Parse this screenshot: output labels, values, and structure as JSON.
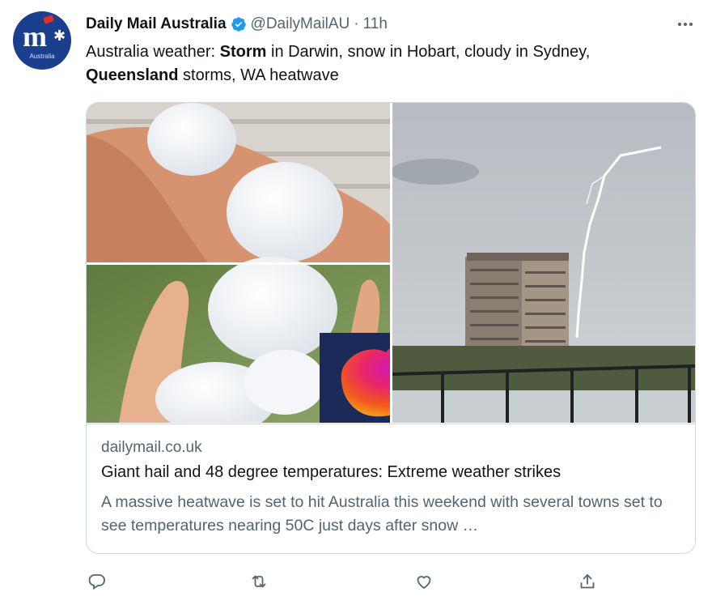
{
  "account": {
    "display_name": "Daily Mail Australia",
    "handle": "@DailyMailAU",
    "separator": "·",
    "time": "11h",
    "verified": true,
    "avatar": {
      "logo_text": "m",
      "logo_sub": "Australia",
      "bg_color": "#1b3f8f"
    }
  },
  "tweet": {
    "segments": [
      {
        "text": "Australia weather: ",
        "bold": false
      },
      {
        "text": "Storm",
        "bold": true
      },
      {
        "text": " in Darwin, snow in Hobart, cloudy in Sydney, ",
        "bold": false
      },
      {
        "text": "Queensland",
        "bold": true
      },
      {
        "text": " storms, WA heatwave",
        "bold": false
      }
    ]
  },
  "card": {
    "domain": "dailymail.co.uk",
    "title": "Giant hail and 48 degree temperatures: Extreme weather strikes",
    "description": "A massive heatwave is set to hit Australia this weekend with several towns set to see temperatures nearing 50C just days after snow …",
    "image_panels": [
      "hailstones-in-hand",
      "hailstones-closeup",
      "australia-heat-map",
      "lightning-over-apartment-tower"
    ]
  },
  "actions": {
    "reply_icon": "reply-icon",
    "retweet_icon": "retweet-icon",
    "like_icon": "like-icon",
    "share_icon": "share-icon"
  },
  "colors": {
    "text_primary": "#0f1419",
    "text_secondary": "#536471",
    "verified_blue": "#1d9bf0",
    "border": "#cfd9de"
  }
}
